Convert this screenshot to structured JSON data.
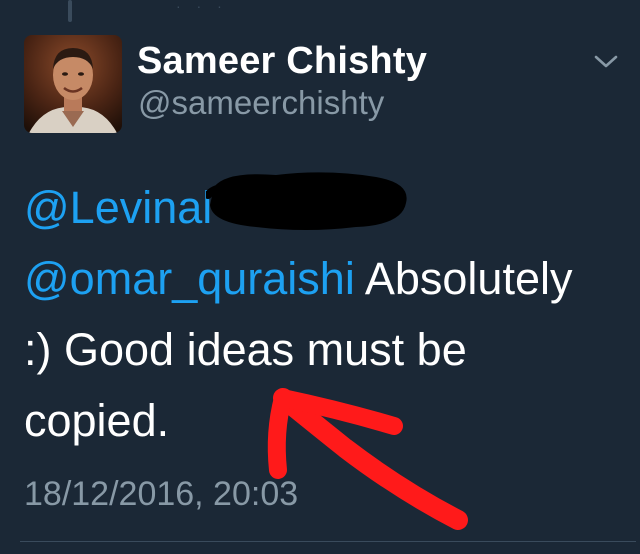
{
  "tweet": {
    "author": {
      "display_name": "Sameer Chishty",
      "handle": "@sameerchishty"
    },
    "text": {
      "mention_1": "@Levinal",
      "mention_2": "@omar_quraishi",
      "body_1": " Absolutely",
      "body_2": ":) Good ideas must be",
      "body_3": "copied."
    },
    "timestamp": "18/12/2016, 20:03"
  },
  "colors": {
    "background": "#1b2836",
    "mention": "#1da1f2",
    "secondary_text": "#8899a6",
    "annotation_arrow": "#ff1a1a"
  },
  "icons": {
    "caret": "chevron-down-icon"
  }
}
